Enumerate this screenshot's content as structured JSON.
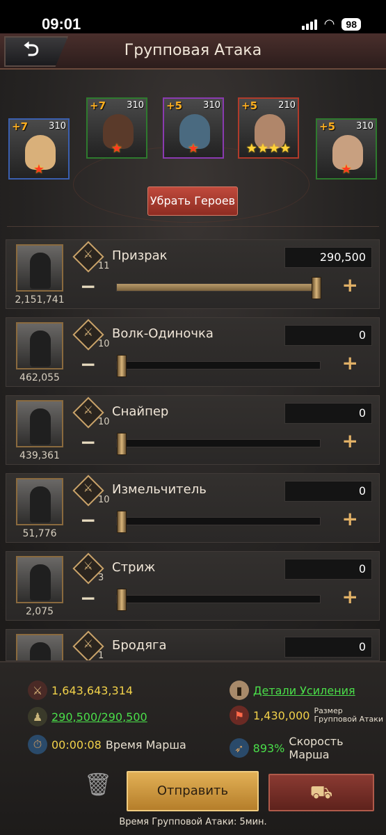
{
  "status_bar": {
    "time": "09:01",
    "battery": "98"
  },
  "header": {
    "title": "Групповая Атака",
    "back_icon": "back-arrow-icon"
  },
  "heroes": [
    {
      "level": "+7",
      "power": "310",
      "stars": "★",
      "frame": "blue"
    },
    {
      "level": "+7",
      "power": "310",
      "stars": "★",
      "frame": "green"
    },
    {
      "level": "+5",
      "power": "310",
      "stars": "★",
      "frame": "purple"
    },
    {
      "level": "+5",
      "power": "210",
      "stars": "★★★★",
      "frame": "red"
    },
    {
      "level": "+5",
      "power": "310",
      "stars": "★",
      "frame": "green"
    }
  ],
  "remove_heroes_label": "Убрать Героев",
  "troops": [
    {
      "name": "Призрак",
      "tier": "11",
      "count": "2,151,741",
      "value": "290,500",
      "slider_fraction": 1.0
    },
    {
      "name": "Волк-Одиночка",
      "tier": "10",
      "count": "462,055",
      "value": "0",
      "slider_fraction": 0.0
    },
    {
      "name": "Снайпер",
      "tier": "10",
      "count": "439,361",
      "value": "0",
      "slider_fraction": 0.0
    },
    {
      "name": "Измельчитель",
      "tier": "10",
      "count": "51,776",
      "value": "0",
      "slider_fraction": 0.0
    },
    {
      "name": "Стриж",
      "tier": "3",
      "count": "2,075",
      "value": "0",
      "slider_fraction": 0.0
    },
    {
      "name": "Бродяга",
      "tier": "1",
      "count": "",
      "value": "0",
      "slider_fraction": 0.0
    }
  ],
  "bottom": {
    "power_value": "1,643,643,314",
    "boost_details_label": "Детали Усиления",
    "troops_value": "290,500/290,500",
    "rally_size_value": "1,430,000",
    "rally_size_label": "Размер Групповой Атаки",
    "march_time_value": "00:00:08",
    "march_time_label": "Время Марша",
    "march_speed_value": "893%",
    "march_speed_label": "Скорость Марша",
    "send_label": "Отправить",
    "rally_time_note": "Время Групповой Атаки: 5мин."
  },
  "colors": {
    "accent_gold": "#e2b056",
    "value_yellow": "#f2d24a",
    "value_green": "#4adf4a",
    "danger_red": "#c04a3c"
  }
}
